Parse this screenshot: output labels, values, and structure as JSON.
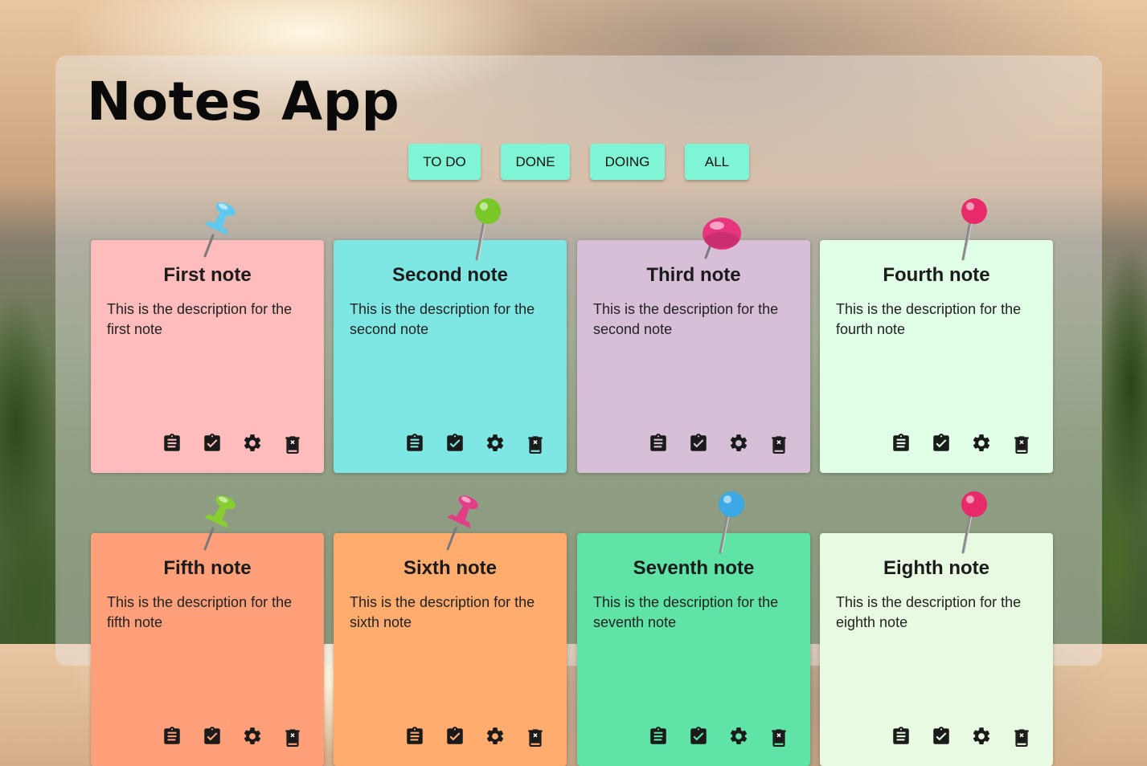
{
  "app": {
    "title": "Notes App"
  },
  "filters": [
    {
      "label": "TO DO"
    },
    {
      "label": "DONE"
    },
    {
      "label": "DOING"
    },
    {
      "label": "ALL"
    }
  ],
  "notes": [
    {
      "title": "First note",
      "description": "This is the description for the first note",
      "color": "#ffbcbc",
      "pin_color": "#5ec8ee",
      "pin_style": "push"
    },
    {
      "title": "Second note",
      "description": "This is the description for the second note",
      "color": "#7fe7e3",
      "pin_color": "#7ac72a",
      "pin_style": "needle"
    },
    {
      "title": "Third note",
      "description": "This is the description for the second note",
      "color": "#d8bfd8",
      "pin_color": "#e8357e",
      "pin_style": "flat"
    },
    {
      "title": "Fourth note",
      "description": "This is the description for the fourth note",
      "color": "#e0ffe6",
      "pin_color": "#e8296a",
      "pin_style": "needle"
    },
    {
      "title": "Fifth note",
      "description": "This is the description for the fifth note",
      "color": "#ffa07a",
      "pin_color": "#86cf2e",
      "pin_style": "push"
    },
    {
      "title": "Sixth note",
      "description": "This is the description for the sixth note",
      "color": "#ffac6e",
      "pin_color": "#e23e86",
      "pin_style": "push"
    },
    {
      "title": "Seventh note",
      "description": "This is the description for the seventh note",
      "color": "#5fe3a6",
      "pin_color": "#3ba9e3",
      "pin_style": "needle"
    },
    {
      "title": "Eighth note",
      "description": "This is the description for the eighth note",
      "color": "#e8fbe2",
      "pin_color": "#e8296a",
      "pin_style": "needle"
    }
  ],
  "note_actions": [
    {
      "icon": "clipboard-list-icon",
      "action": "todo"
    },
    {
      "icon": "clipboard-check-icon",
      "action": "done"
    },
    {
      "icon": "gear-icon",
      "action": "settings"
    },
    {
      "icon": "trash-icon",
      "action": "delete"
    }
  ]
}
